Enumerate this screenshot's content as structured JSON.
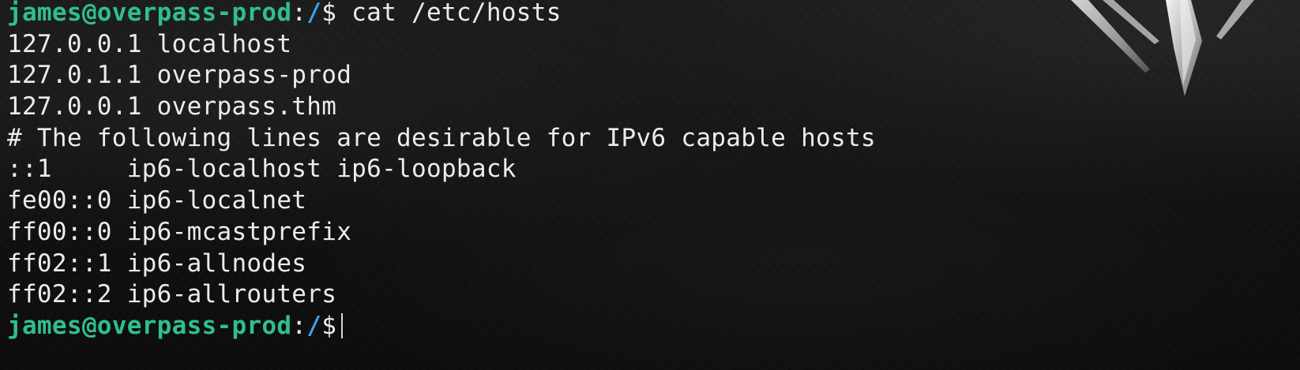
{
  "terminal": {
    "prompt_user": "james@overpass-prod",
    "prompt_sep": ":",
    "prompt_path": "/",
    "prompt_symbol": "$",
    "command": " cat /etc/hosts",
    "output_lines": [
      "127.0.0.1 localhost",
      "127.0.1.1 overpass-prod",
      "127.0.0.1 overpass.thm",
      "# The following lines are desirable for IPv6 capable hosts",
      "::1     ip6-localhost ip6-loopback",
      "fe00::0 ip6-localnet",
      "ff00::0 ip6-mcastprefix",
      "ff02::1 ip6-allnodes",
      "ff02::2 ip6-allrouters"
    ]
  },
  "colors": {
    "prompt_user": "#2fbf8f",
    "prompt_path": "#3aa3ef",
    "text": "#ececec"
  }
}
